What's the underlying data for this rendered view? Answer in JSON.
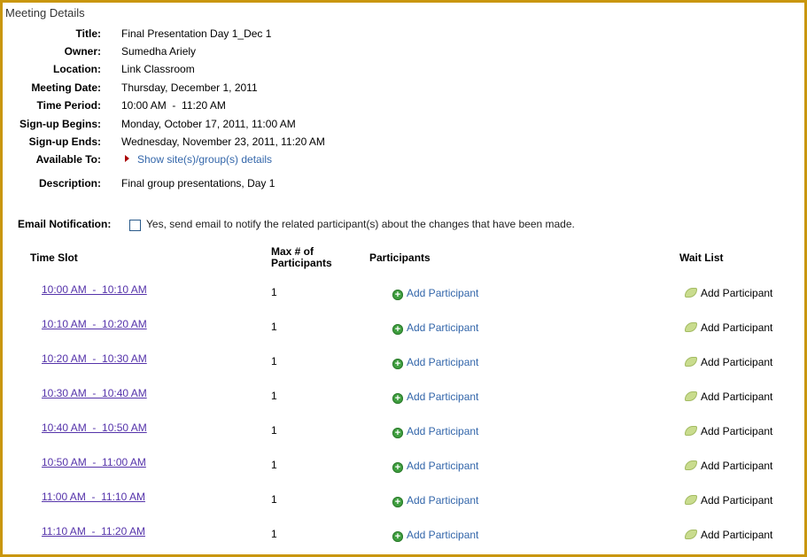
{
  "section_title": "Meeting Details",
  "details": [
    {
      "label": "Title:",
      "value": "Final Presentation Day 1_Dec 1"
    },
    {
      "label": "Owner:",
      "value": "Sumedha Ariely"
    },
    {
      "label": "Location:",
      "value": "Link Classroom"
    },
    {
      "label": "Meeting Date:",
      "value": "Thursday, December 1, 2011"
    },
    {
      "label": "Time Period:",
      "value": "10:00 AM  -  11:20 AM"
    },
    {
      "label": "Sign-up Begins:",
      "value": "Monday, October 17, 2011, 11:00 AM"
    },
    {
      "label": "Sign-up Ends:",
      "value": "Wednesday, November 23, 2011, 11:20 AM"
    }
  ],
  "available_to": {
    "label": "Available To:",
    "link": "Show site(s)/group(s) details"
  },
  "description": {
    "label": "Description:",
    "value": "Final group presentations, Day 1"
  },
  "email_notification": {
    "label": "Email Notification:",
    "checkbox_text": "Yes, send email to notify the related participant(s) about the changes that have been made.",
    "checked": false
  },
  "table": {
    "headers": {
      "time_slot": "Time Slot",
      "max_line1": "Max # of",
      "max_line2": "Participants",
      "participants": "Participants",
      "wait_list": "Wait List"
    },
    "rows": [
      {
        "slot": "10:00 AM  -  10:10 AM",
        "max": "1",
        "add": "Add Participant",
        "wait": "Add Participant"
      },
      {
        "slot": "10:10 AM  -  10:20 AM",
        "max": "1",
        "add": "Add Participant",
        "wait": "Add Participant"
      },
      {
        "slot": "10:20 AM  -  10:30 AM",
        "max": "1",
        "add": "Add Participant",
        "wait": "Add Participant"
      },
      {
        "slot": "10:30 AM  -  10:40 AM",
        "max": "1",
        "add": "Add Participant",
        "wait": "Add Participant"
      },
      {
        "slot": "10:40 AM  -  10:50 AM",
        "max": "1",
        "add": "Add Participant",
        "wait": "Add Participant"
      },
      {
        "slot": "10:50 AM  -  11:00 AM",
        "max": "1",
        "add": "Add Participant",
        "wait": "Add Participant"
      },
      {
        "slot": "11:00 AM  -  11:10 AM",
        "max": "1",
        "add": "Add Participant",
        "wait": "Add Participant"
      },
      {
        "slot": "11:10 AM  -  11:20 AM",
        "max": "1",
        "add": "Add Participant",
        "wait": "Add Participant"
      }
    ]
  },
  "icons": {
    "expand": "triangle-right-icon",
    "add": "add-circle-icon",
    "wait": "leaf-icon"
  },
  "colors": {
    "frame": "#c9960c",
    "link": "#3366aa",
    "slot_link": "#5533aa",
    "triangle": "#aa0000"
  }
}
